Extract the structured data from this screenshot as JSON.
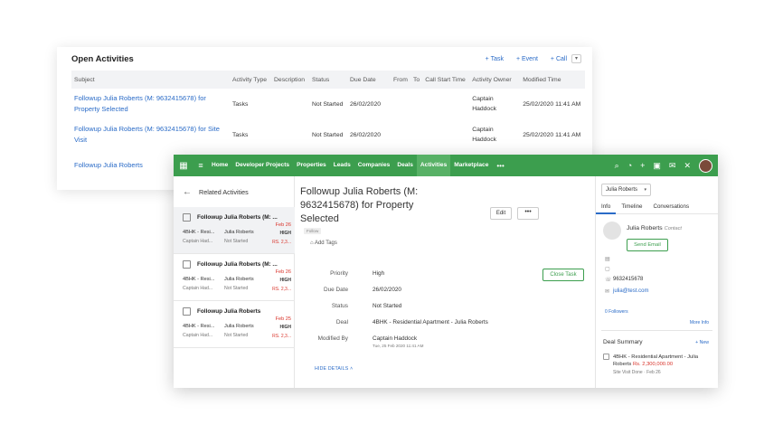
{
  "open_activities": {
    "title": "Open Activities",
    "actions": [
      "+ Task",
      "+ Event",
      "+ Call"
    ],
    "columns": [
      "Subject",
      "Activity Type",
      "Description",
      "Status",
      "Due Date",
      "From",
      "To",
      "Call Start Time",
      "Activity Owner",
      "Modified Time"
    ],
    "rows": [
      {
        "subject": "Followup Julia Roberts (M: 9632415678) for Property Selected",
        "type": "Tasks",
        "description": "",
        "status": "Not Started",
        "due": "26/02/2020",
        "from": "",
        "to": "",
        "call_start": "",
        "owner": "Captain Haddock",
        "modified": "25/02/2020 11:41 AM"
      },
      {
        "subject": "Followup Julia Roberts (M: 9632415678) for Site Visit",
        "type": "Tasks",
        "description": "",
        "status": "Not Started",
        "due": "26/02/2020",
        "from": "",
        "to": "",
        "call_start": "",
        "owner": "Captain Haddock",
        "modified": "25/02/2020 11:41 AM"
      },
      {
        "subject": "Followup Julia Roberts",
        "type": "",
        "description": "",
        "status": "",
        "due": "",
        "from": "",
        "to": "",
        "call_start": "",
        "owner": "",
        "modified": ""
      }
    ]
  },
  "nav": {
    "items": [
      "Home",
      "Developer Projects",
      "Properties",
      "Leads",
      "Companies",
      "Deals",
      "Activities",
      "Marketplace"
    ],
    "active": "Activities",
    "more": "•••"
  },
  "related": {
    "title": "Related Activities",
    "items": [
      {
        "title": "Followup Julia Roberts (M: ...",
        "date": "Feb 26",
        "deal": "4BHK - Resi...",
        "contact": "Julia Roberts",
        "priority": "HIGH",
        "owner": "Captain Had...",
        "status": "Not Started",
        "amount": "RS. 2,3..."
      },
      {
        "title": "Followup Julia Roberts (M: ...",
        "date": "Feb 26",
        "deal": "4BHK - Resi...",
        "contact": "Julia Roberts",
        "priority": "HIGH",
        "owner": "Captain Had...",
        "status": "Not Started",
        "amount": "RS. 2,3..."
      },
      {
        "title": "Followup Julia Roberts",
        "date": "Feb 25",
        "deal": "4BHK - Resi...",
        "contact": "Julia Roberts",
        "priority": "HIGH",
        "owner": "Captain Had...",
        "status": "Not Started",
        "amount": "RS. 2,3..."
      }
    ]
  },
  "detail": {
    "title": "Followup Julia Roberts (M: 9632415678) for Property Selected",
    "follow": "Follow",
    "add_tags": "Add Tags",
    "edit": "Edit",
    "more": "•••",
    "close_task": "Close Task",
    "fields": [
      {
        "label": "Priority",
        "value": "High"
      },
      {
        "label": "Due Date",
        "value": "26/02/2020"
      },
      {
        "label": "Status",
        "value": "Not Started"
      },
      {
        "label": "Deal",
        "value": "4BHK - Residential Apartment - Julia Roberts"
      },
      {
        "label": "Modified By",
        "value": "Captain Haddock",
        "sub": "Tue, 25 Feb 2020 11:41 AM"
      }
    ],
    "hide_details": "HIDE DETAILS"
  },
  "info": {
    "select": "Julia Roberts",
    "tabs": [
      "Info",
      "Timeline",
      "Conversations"
    ],
    "name": "Julia Roberts",
    "type": "Contact",
    "send_email": "Send Email",
    "phone": "9632415678",
    "email": "julia@test.com",
    "followers": "0 Followers",
    "more_info": "More Info",
    "deal_summary": "Deal Summary",
    "new": "+ New",
    "deal_name": "4BHK - Residential Apartment - Julia Roberts",
    "deal_amount": "Rs. 2,300,000.00",
    "deal_stage": "Site Visit Done · Feb 26"
  },
  "colors": {
    "nav": "#3c9e4e",
    "link": "#2a6bc7",
    "accent_red": "#d9342b"
  }
}
